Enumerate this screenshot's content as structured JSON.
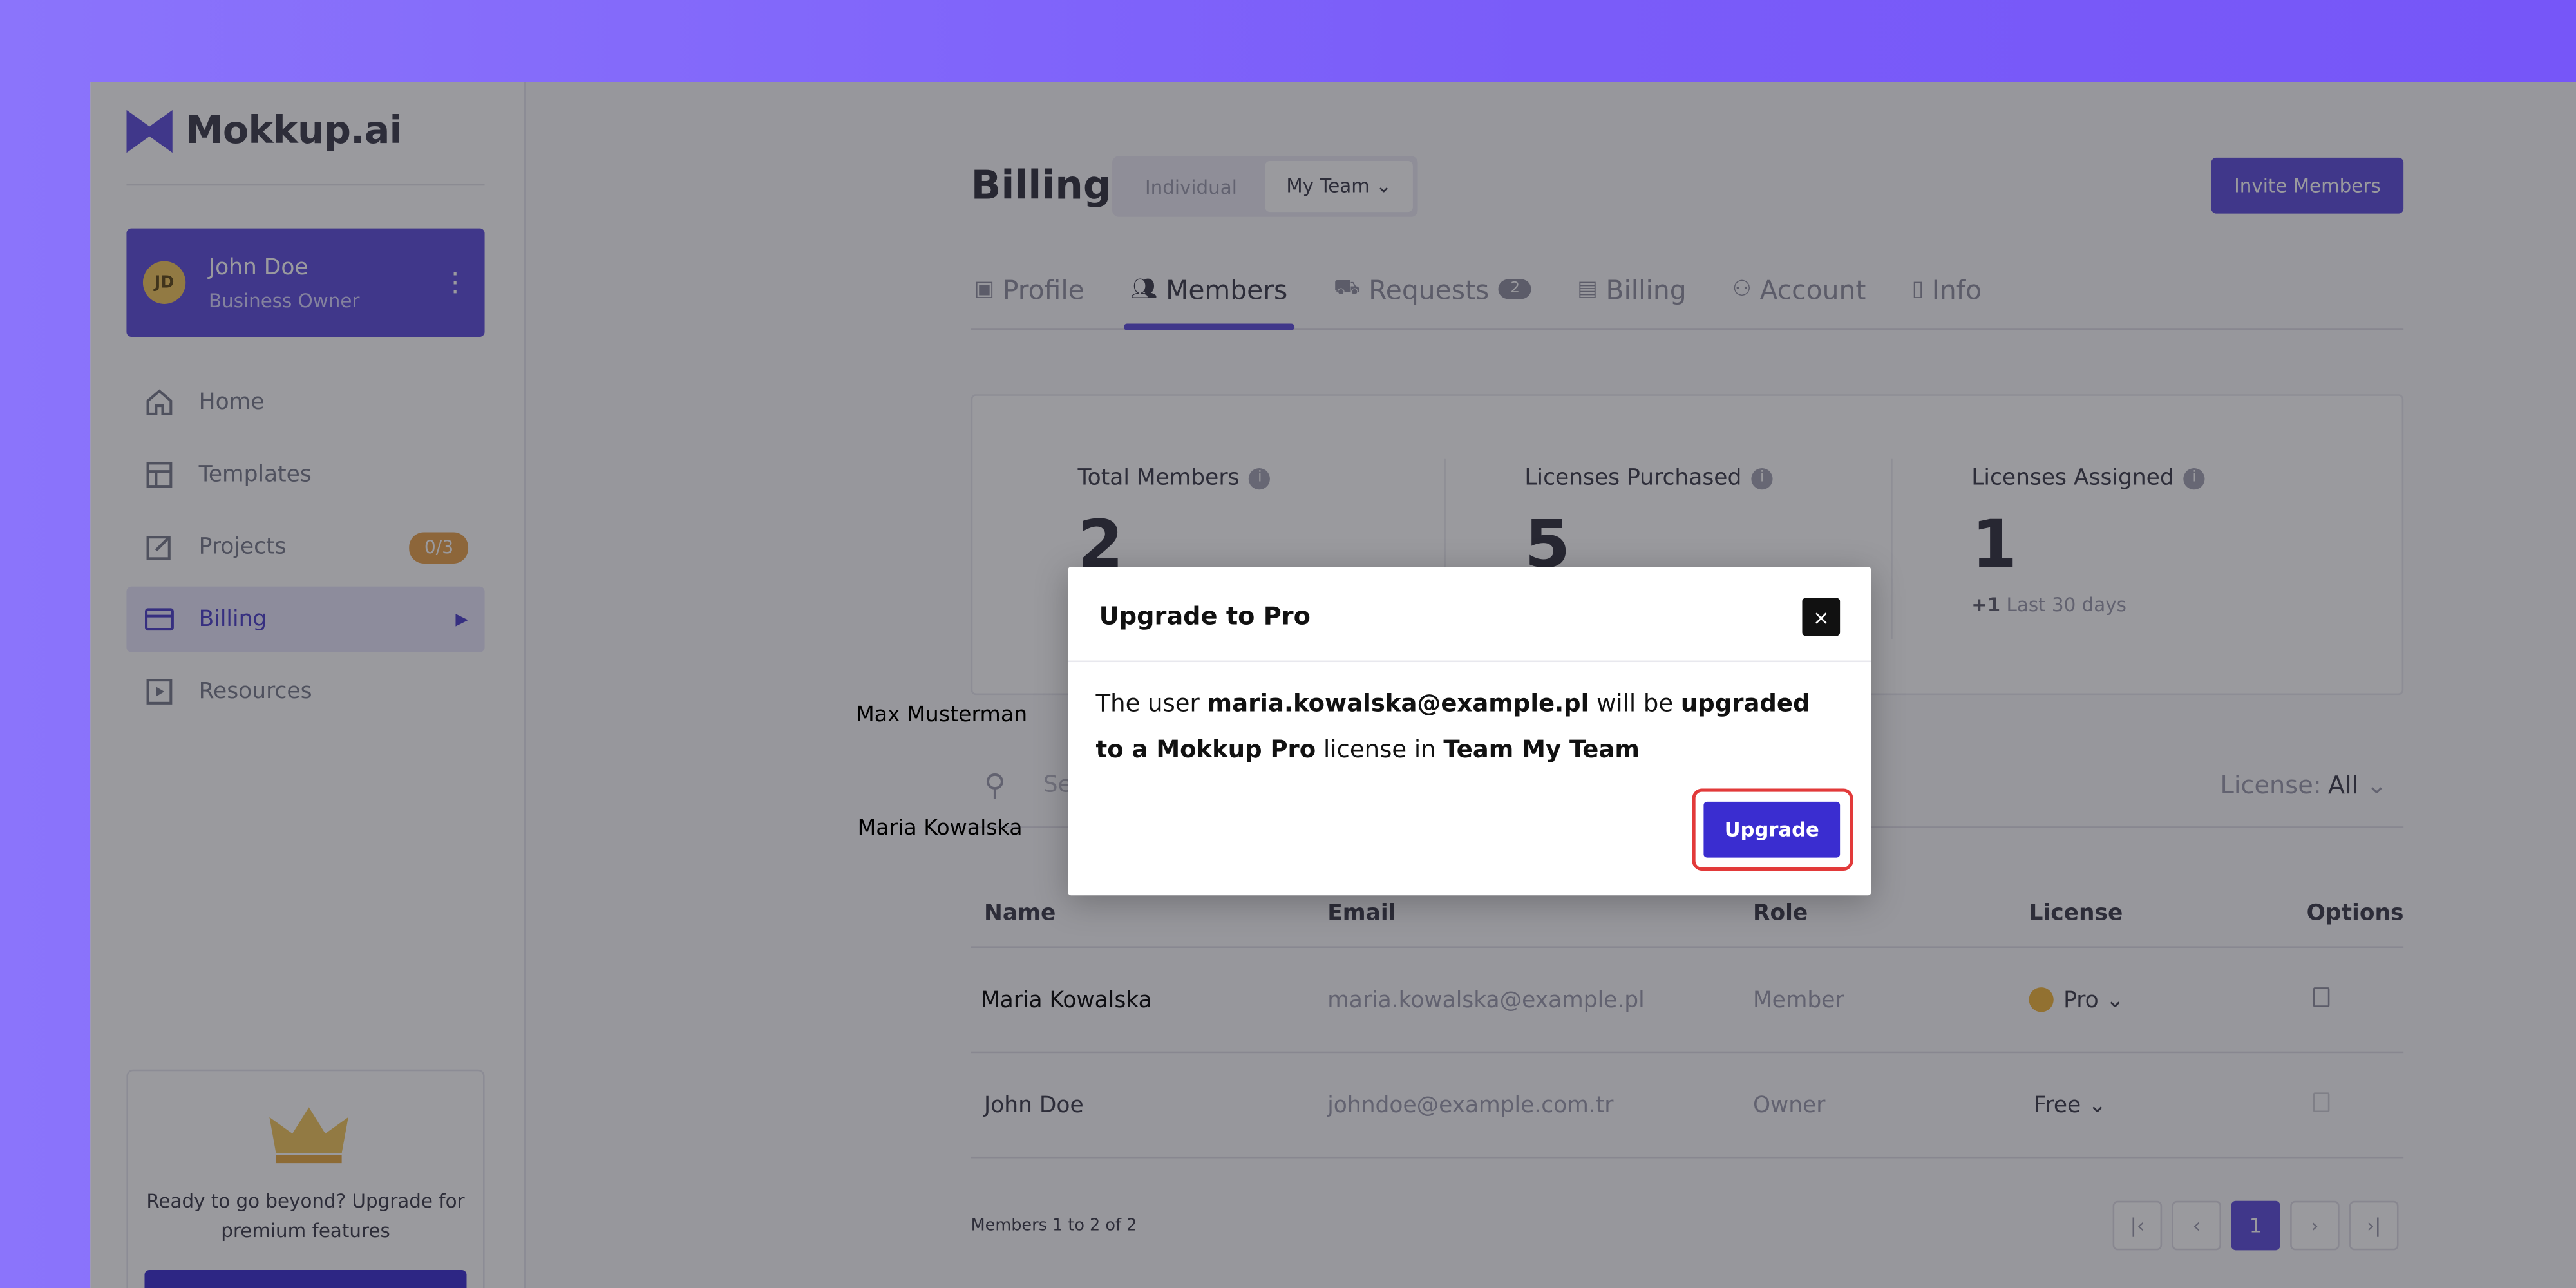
{
  "brand": {
    "name": "Mokkup.ai"
  },
  "user": {
    "initials": "JD",
    "name": "John Doe",
    "role": "Business Owner"
  },
  "nav": [
    {
      "label": "Home",
      "icon": "home-icon"
    },
    {
      "label": "Templates",
      "icon": "templates-icon"
    },
    {
      "label": "Projects",
      "icon": "edit-icon",
      "badge": "0/3"
    },
    {
      "label": "Billing",
      "icon": "credit-card-icon",
      "active": true
    },
    {
      "label": "Resources",
      "icon": "play-icon"
    }
  ],
  "promo": {
    "text": "Ready to go beyond? Upgrade for premium features"
  },
  "page": {
    "title": "Billing",
    "segment": [
      "Individual",
      "My Team"
    ],
    "invite_label": "Invite Members"
  },
  "tabs": [
    {
      "label": "Profile",
      "icon": "profile-icon"
    },
    {
      "label": "Members",
      "icon": "members-icon",
      "active": true
    },
    {
      "label": "Requests",
      "icon": "requests-icon",
      "count": "2"
    },
    {
      "label": "Billing",
      "icon": "invoice-icon"
    },
    {
      "label": "Account",
      "icon": "account-icon"
    },
    {
      "label": "Info",
      "icon": "info-icon"
    }
  ],
  "stats": [
    {
      "label": "Total Members",
      "value": "2",
      "sub": ""
    },
    {
      "label": "Licenses Purchased",
      "value": "5",
      "sub": ""
    },
    {
      "label": "Licenses Assigned",
      "value": "1",
      "sub_delta": "+1",
      "sub": "Last 30 days"
    }
  ],
  "search": {
    "placeholder": "Se",
    "license_label": "License:",
    "license_value": "All"
  },
  "table": {
    "headers": [
      "Name",
      "Email",
      "Role",
      "License",
      "Options"
    ],
    "rows": [
      {
        "name": "Maria Kowalska",
        "email": "maria.kowalska@example.pl",
        "role": "Member",
        "license": "Pro"
      },
      {
        "name": "John Doe",
        "email": "johndoe@example.com.tr",
        "role": "Owner",
        "license": "Free"
      }
    ]
  },
  "footer": {
    "range": "Members 1 to 2 of 2",
    "page": "1"
  },
  "floating_labels": [
    "Max Musterman",
    "Maria Kowalska"
  ],
  "modal": {
    "title": "Upgrade to Pro",
    "close": "×",
    "body": {
      "p1": "The user ",
      "email": "maria.kowalska@example.pl",
      "p2": " will be ",
      "strong1": "upgraded to a Mokkup Pro",
      "p3": " license in ",
      "strong2": "Team My Team"
    },
    "button": "Upgrade"
  },
  "colors": {
    "accent": "#5b4bdb",
    "upgrade": "#3a2dd0",
    "highlight": "#e23a3a"
  }
}
